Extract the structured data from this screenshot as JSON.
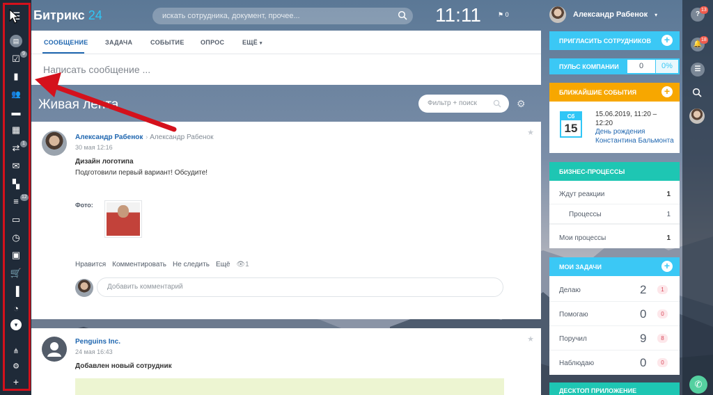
{
  "app": {
    "logo_main": "Битрикс",
    "logo_suffix": "24",
    "search_placeholder": "искать сотрудника, документ, прочее...",
    "clock": "11:11",
    "flag_count": "0",
    "user_name": "Александр Рабенок"
  },
  "left_menu": {
    "badges": {
      "tasks": "9",
      "sync": "1",
      "filter": "12"
    },
    "items": [
      "menu-icon",
      "feed-icon",
      "tasks-icon",
      "chat-icon",
      "groups-icon",
      "drive-icon",
      "calendar-icon",
      "sync-icon",
      "mail-icon",
      "apps-icon",
      "filter-icon",
      "window-icon",
      "clock-icon",
      "contact-card-icon",
      "cart-icon",
      "analytics-icon",
      "timeman-icon",
      "chevron-down-icon",
      "structure-icon",
      "gear-icon",
      "plus-icon"
    ]
  },
  "right_strip": {
    "help_badge": "13",
    "notify_badge": "18"
  },
  "composer": {
    "tabs": [
      "СООБЩЕНИЕ",
      "ЗАДАЧА",
      "СОБЫТИЕ",
      "ОПРОС",
      "ЕЩЁ"
    ],
    "placeholder": "Написать сообщение ..."
  },
  "feed": {
    "title": "Живая лента",
    "filter_placeholder": "Фильтр + поиск"
  },
  "post1": {
    "author": "Александр Рабенок",
    "recipient": "Александр Рабенок",
    "time": "30 мая 12:16",
    "title": "Дизайн логотипа",
    "text": "Подготовили первый вариант! Обсудите!",
    "photo_label": "Фото:",
    "actions": {
      "like": "Нравится",
      "comment": "Комментировать",
      "unfollow": "Не следить",
      "more": "Ещё",
      "views": "1"
    },
    "comment_placeholder": "Добавить комментарий"
  },
  "post2": {
    "author": "Penguins Inc.",
    "time": "24 мая 16:43",
    "title": "Добавлен новый сотрудник"
  },
  "sidebar": {
    "invite": "ПРИГЛАСИТЬ СОТРУДНИКОВ",
    "pulse": {
      "label": "ПУЛЬС КОМПАНИИ",
      "value": "0",
      "percent": "0%"
    },
    "events": {
      "title": "БЛИЖАЙШИЕ СОБЫТИЯ",
      "cal_day": "Сб",
      "cal_num": "15",
      "date": "15.06.2019, 11:20 – 12:20",
      "name": "День рождения Константина Бальмонта"
    },
    "bp": {
      "title": "БИЗНЕС-ПРОЦЕССЫ",
      "rows": [
        {
          "label": "Ждут реакции",
          "value": "1"
        },
        {
          "label": "Процессы",
          "value": "1"
        },
        {
          "label": "Мои процессы",
          "value": "1"
        }
      ]
    },
    "tasks": {
      "title": "МОИ ЗАДАЧИ",
      "rows": [
        {
          "label": "Делаю",
          "count": "2",
          "badge": "1"
        },
        {
          "label": "Помогаю",
          "count": "0",
          "badge": "0"
        },
        {
          "label": "Поручил",
          "count": "9",
          "badge": "8"
        },
        {
          "label": "Наблюдаю",
          "count": "0",
          "badge": "0"
        }
      ]
    },
    "desktop": "ДЕСКТОП ПРИЛОЖЕНИЕ"
  },
  "colors": {
    "accent_blue": "#3bc8f5",
    "events_orange": "#f7a700",
    "bp_teal": "#1ec6b3",
    "link_blue": "#2067b0",
    "annotation_red": "#d4111c"
  }
}
